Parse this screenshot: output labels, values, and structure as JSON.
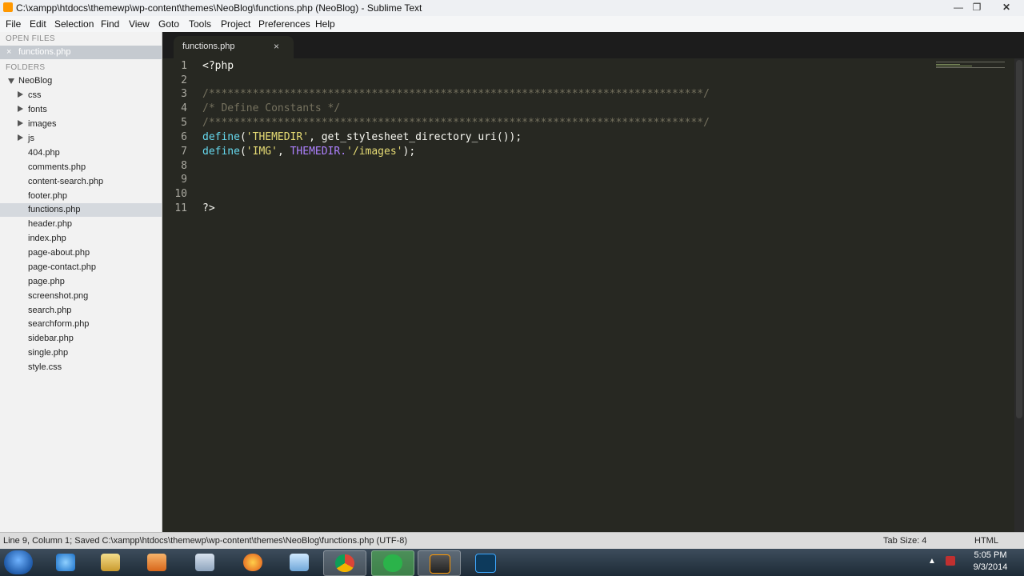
{
  "window": {
    "title": "C:\\xampp\\htdocs\\themewp\\wp-content\\themes\\NeoBlog\\functions.php (NeoBlog) - Sublime Text",
    "minimize": "—",
    "maximize": "❐",
    "close": "✕"
  },
  "menu": [
    "File",
    "Edit",
    "Selection",
    "Find",
    "View",
    "Goto",
    "Tools",
    "Project",
    "Preferences",
    "Help"
  ],
  "sidebar": {
    "open_files_header": "OPEN FILES",
    "open_file": "functions.php",
    "open_file_close": "×",
    "folders_header": "FOLDERS",
    "root_folder": "NeoBlog",
    "subfolders": [
      "css",
      "fonts",
      "images",
      "js"
    ],
    "files": [
      "404.php",
      "comments.php",
      "content-search.php",
      "footer.php",
      "functions.php",
      "header.php",
      "index.php",
      "page-about.php",
      "page-contact.php",
      "page.php",
      "screenshot.png",
      "search.php",
      "searchform.php",
      "sidebar.php",
      "single.php",
      "style.css"
    ],
    "selected_file": "functions.php"
  },
  "tab": {
    "label": "functions.php",
    "close": "×"
  },
  "editor": {
    "line_numbers": [
      "1",
      "2",
      "3",
      "4",
      "5",
      "6",
      "7",
      "8",
      "9",
      "10",
      "11"
    ],
    "lines": {
      "l1": "<?php",
      "l3": "/*******************************************************************************/",
      "l4": "/* Define Constants */",
      "l5": "/*******************************************************************************/",
      "l6_fn": "define",
      "l6_open": "(",
      "l6_str": "'THEMEDIR'",
      "l6_mid": ", get_stylesheet_directory_uri());",
      "l7_fn": "define",
      "l7_open": "(",
      "l7_str": "'IMG'",
      "l7_comma": ", ",
      "l7_const": "THEMEDIR.",
      "l7_str2": "'/images'",
      "l7_end": ");",
      "l11": "?>"
    }
  },
  "status": {
    "left": "Line 9, Column 1; Saved C:\\xampp\\htdocs\\themewp\\wp-content\\themes\\NeoBlog\\functions.php (UTF-8)",
    "tab_size": "Tab Size: 4",
    "syntax": "HTML"
  },
  "taskbar": {
    "time": "5:05 PM",
    "date": "9/3/2014",
    "tray_arrow": "▲"
  },
  "colors": {
    "editor_bg": "#272822",
    "comment": "#75715e",
    "string": "#e6db74",
    "function": "#66d9ef",
    "constant": "#ae81ff"
  }
}
